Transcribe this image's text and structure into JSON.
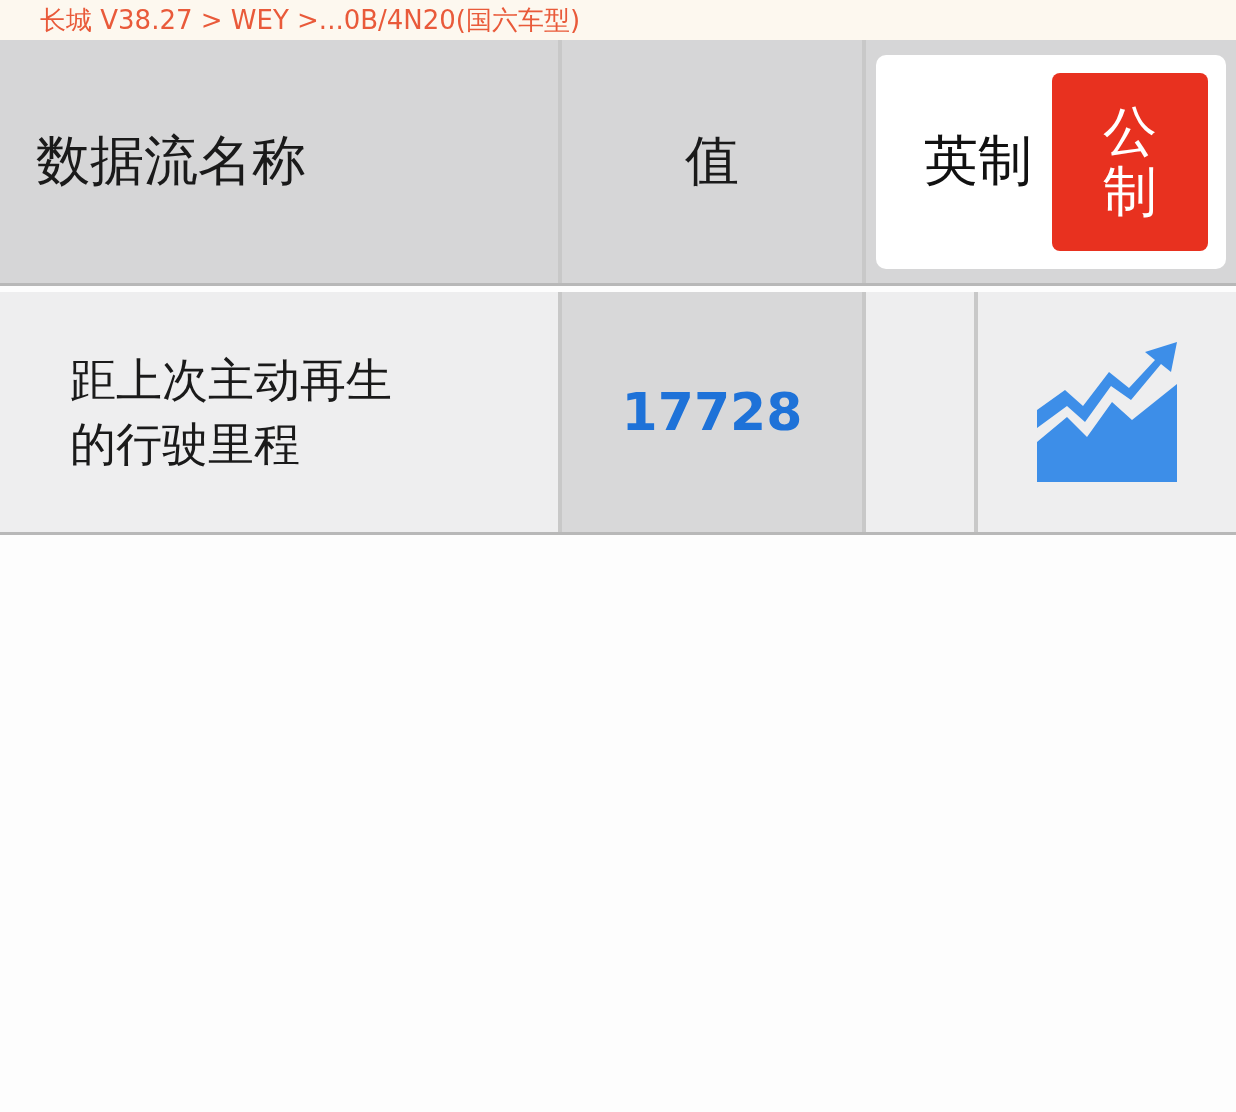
{
  "title": "长城 V38.27 > WEY >...0B/4N20(国六车型)",
  "header": {
    "name_column": "数据流名称",
    "value_column": "值",
    "unit_toggle": [
      {
        "label": "英制",
        "selected": false
      },
      {
        "label": "公制",
        "selected": true
      }
    ]
  },
  "rows": [
    {
      "name": "距上次主动再生的行驶里程",
      "value": "17728"
    }
  ]
}
